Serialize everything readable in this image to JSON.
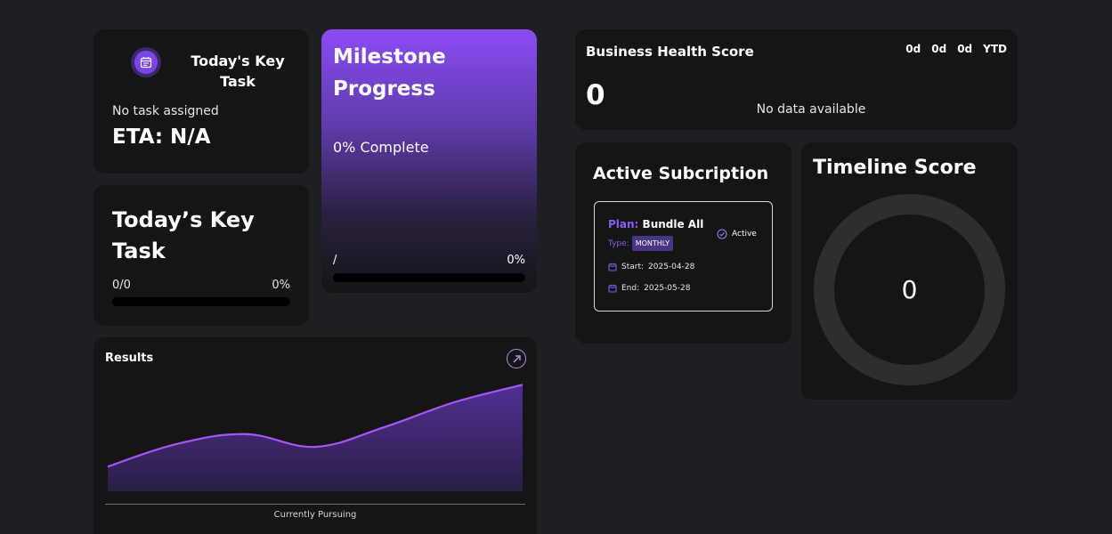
{
  "key_task_card": {
    "title": "Today's Key Task",
    "status": "No task assigned",
    "eta": "ETA: N/A"
  },
  "key_task_progress": {
    "title": "Today’s Key Task",
    "count": "0/0",
    "percent_label": "0%",
    "progress": 0
  },
  "milestone": {
    "title": "Milestone Progress",
    "complete_label": "0% Complete",
    "slash": "/",
    "percent_label": "0%",
    "progress": 0
  },
  "results": {
    "title": "Results",
    "caption": "Currently Pursuing"
  },
  "chart_data": {
    "type": "area",
    "title": "Results",
    "xlabel": "Currently Pursuing",
    "ylabel": "",
    "x": [
      0,
      1,
      2,
      3,
      4,
      5,
      6
    ],
    "values": [
      2.5,
      4.8,
      5.8,
      4.5,
      6.5,
      9.0,
      10.8
    ],
    "ylim": [
      0,
      12
    ],
    "grid": false,
    "color": "#a855f7"
  },
  "health": {
    "title": "Business Health Score",
    "periods": [
      "0d",
      "0d",
      "0d",
      "YTD"
    ],
    "score": "0",
    "no_data": "No data available"
  },
  "subscription": {
    "title": "Active Subcription",
    "plan_key": "Plan:",
    "plan_value": "Bundle All",
    "type_key": "Type:",
    "type_value": "MONTHLY",
    "status": "Active",
    "start_label": "Start:",
    "start_value": "2025-04-28",
    "end_label": "End:",
    "end_value": "2025-05-28"
  },
  "timeline": {
    "title": "Timeline Score",
    "score": "0",
    "progress": 0
  },
  "colors": {
    "accent": "#8b5cf6",
    "card": "#151516",
    "background": "#1e1f23"
  }
}
